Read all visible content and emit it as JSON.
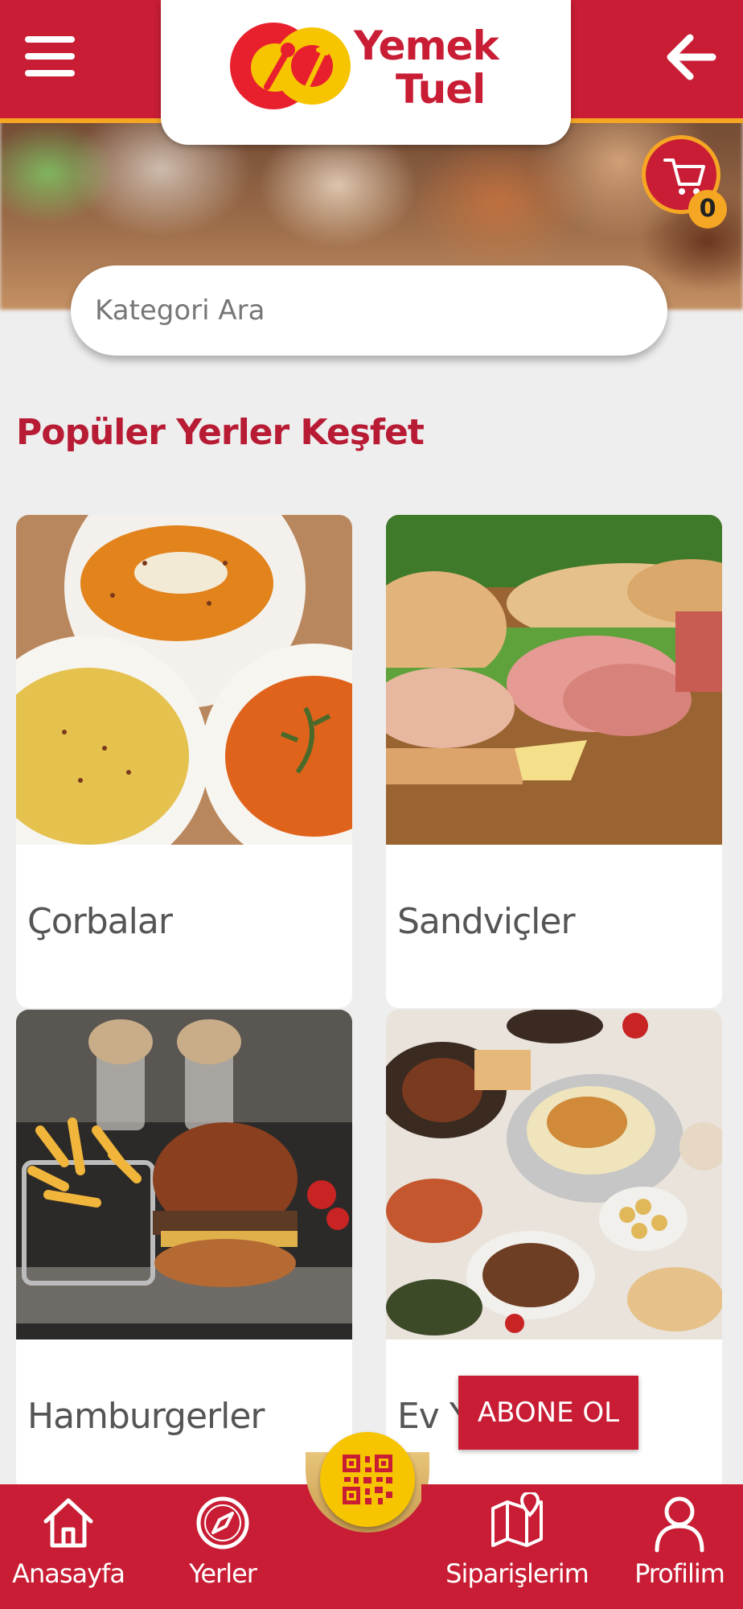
{
  "app": {
    "logo_line1": "Yemek",
    "logo_line2": "Tuel",
    "brand_color": "#c81d34",
    "accent_color": "#f5a623"
  },
  "header": {
    "menu_icon": "hamburger-menu-icon",
    "back_icon": "arrow-left-icon",
    "cart_icon": "shopping-cart-icon",
    "cart_count": "0"
  },
  "search": {
    "placeholder": "Kategori Ara",
    "value": ""
  },
  "section": {
    "title": "Popüler Yerler Keşfet"
  },
  "categories": [
    {
      "label": "Çorbalar",
      "image": "soup-bowls"
    },
    {
      "label": "Sandviçler",
      "image": "sandwiches"
    },
    {
      "label": "Hamburgerler",
      "image": "burger-and-fries"
    },
    {
      "label": "Ev Y",
      "image": "home-cooked-spread"
    }
  ],
  "subscribe": {
    "label": "ABONE OL"
  },
  "bottom_nav": {
    "items": [
      {
        "label": "Anasayfa",
        "icon": "home-icon"
      },
      {
        "label": "Yerler",
        "icon": "compass-icon"
      },
      {
        "label": "Siparişlerim",
        "icon": "map-pin-icon"
      },
      {
        "label": "Profilim",
        "icon": "user-icon"
      }
    ],
    "center_icon": "qr-code-icon"
  }
}
